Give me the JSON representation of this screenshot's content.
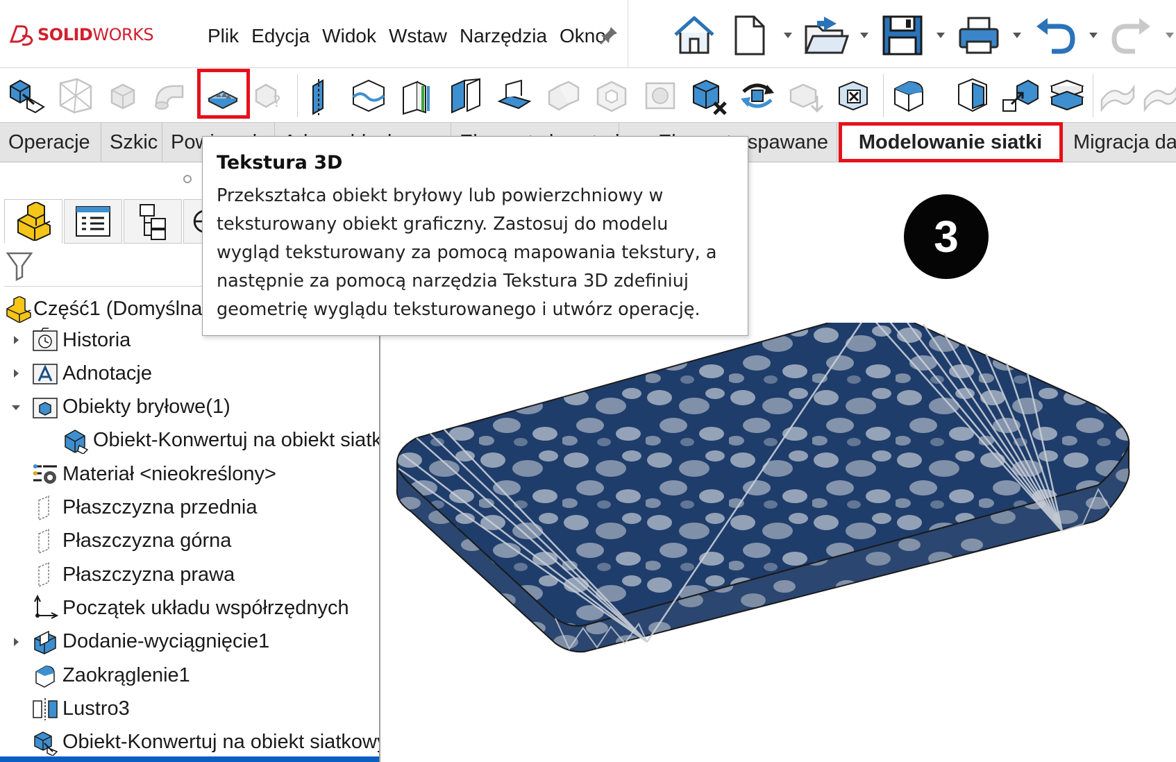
{
  "app": {
    "brand_bold": "SOLID",
    "brand_light": "WORKS"
  },
  "menu": [
    "Plik",
    "Edycja",
    "Widok",
    "Wstaw",
    "Narzędzia",
    "Okno"
  ],
  "quick_access": [
    "home-icon",
    "new-document-icon",
    "open-icon",
    "save-icon",
    "print-icon",
    "undo-icon",
    "redo-icon"
  ],
  "toolbar": {
    "icons": [
      "convert-to-mesh-body-icon",
      "mesh-grid-icon",
      "box-icon",
      "sweep-icon",
      "texture-3d-icon",
      "help-query-icon",
      "split-line-icon",
      "surface-icon",
      "thicken-icon",
      "segment-icon",
      "surface-patch-icon",
      "combine-icon",
      "cavity-icon",
      "cut-icon",
      "delete-body-icon",
      "move-copy-icon",
      "offset-icon",
      "delete-face-icon",
      "fillet-body-icon",
      "section-icon",
      "scale-icon",
      "stack-icon",
      "ruled-surface-icon",
      "surface-extra-icon"
    ],
    "highlighted": "texture-3d-icon"
  },
  "tabs": [
    "Operacje",
    "Szkic",
    "Powierzchnie",
    "Arkusz blachy",
    "Elementy konstrukcyjne",
    "Elementy spawane",
    "Modelowanie siatki",
    "Migracja danych"
  ],
  "active_tab": "Modelowanie siatki",
  "tooltip": {
    "title": "Tekstura 3D",
    "lines": [
      "Przekształca obiekt bryłowy lub powierzchniowy w",
      "teksturowany obiekt graficzny. Zastosuj do modelu",
      "wygląd teksturowany za pomocą mapowania tekstury, a",
      "następnie za pomocą narzędzia Tekstura 3D zdefiniuj",
      "geometrię wyglądu teksturowanego i utwórz operację."
    ]
  },
  "tree": {
    "root": "Część1 (Domyślna)",
    "items": [
      {
        "label": "Historia",
        "icon": "history-folder-icon",
        "expander": "collapsed"
      },
      {
        "label": "Adnotacje",
        "icon": "annotations-icon",
        "expander": "collapsed"
      },
      {
        "label": "Obiekty bryłowe(1)",
        "icon": "solid-bodies-folder-icon",
        "expander": "expanded"
      },
      {
        "label": "Obiekt-Konwertuj na obiekt siatkowy",
        "icon": "mesh-body-icon",
        "expander": "none"
      },
      {
        "label": "Materiał <nieokreślony>",
        "icon": "material-icon",
        "expander": "none"
      },
      {
        "label": "Płaszczyzna przednia",
        "icon": "plane-icon",
        "expander": "none"
      },
      {
        "label": "Płaszczyzna górna",
        "icon": "plane-icon",
        "expander": "none"
      },
      {
        "label": "Płaszczyzna prawa",
        "icon": "plane-icon",
        "expander": "none"
      },
      {
        "label": "Początek układu współrzędnych",
        "icon": "origin-icon",
        "expander": "none"
      },
      {
        "label": "Dodanie-wyciągnięcie1",
        "icon": "extrude-icon",
        "expander": "collapsed"
      },
      {
        "label": "Zaokrąglenie1",
        "icon": "fillet-icon",
        "expander": "none"
      },
      {
        "label": "Lustro3",
        "icon": "mirror-icon",
        "expander": "none"
      },
      {
        "label": "Obiekt-Konwertuj na obiekt siatkowy",
        "icon": "convert-mesh-icon",
        "expander": "none"
      }
    ]
  },
  "badge": "3",
  "colors": {
    "highlight": "#e5111b",
    "brand": "#d0202e",
    "texture_base": "#1f3d6b",
    "texture_cloud": "#b9c2cf"
  }
}
